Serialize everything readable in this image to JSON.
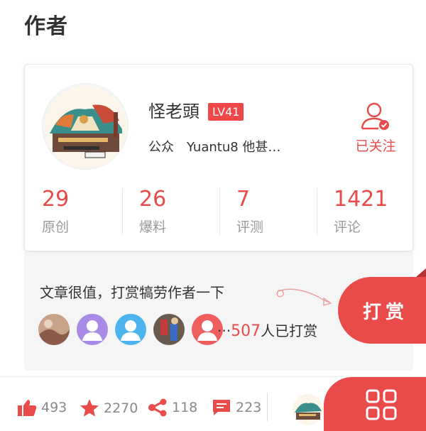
{
  "section_title": "作者",
  "author": {
    "name": "怪老頭",
    "level": "LV41",
    "bio": "公众　Yuantu8 他甚…",
    "follow_label": "已关注"
  },
  "stats": [
    {
      "value": "29",
      "label": "原创"
    },
    {
      "value": "26",
      "label": "爆料"
    },
    {
      "value": "7",
      "label": "评测"
    },
    {
      "value": "1421",
      "label": "评论"
    }
  ],
  "reward": {
    "prompt": "文章很值，打赏犒劳作者一下",
    "count_prefix": "···",
    "count": "507",
    "count_suffix": "人已打赏",
    "button_label": "打赏"
  },
  "actions": {
    "likes": "493",
    "favorites": "2270",
    "shares": "118",
    "comments": "223"
  },
  "colors": {
    "accent": "#e94a4a",
    "muted": "#999999",
    "panel": "#f5f5f5"
  },
  "icons": [
    "user-check-icon",
    "thumbs-up-icon",
    "star-icon",
    "share-icon",
    "comment-icon",
    "grid-menu-icon",
    "arrow-icon"
  ]
}
